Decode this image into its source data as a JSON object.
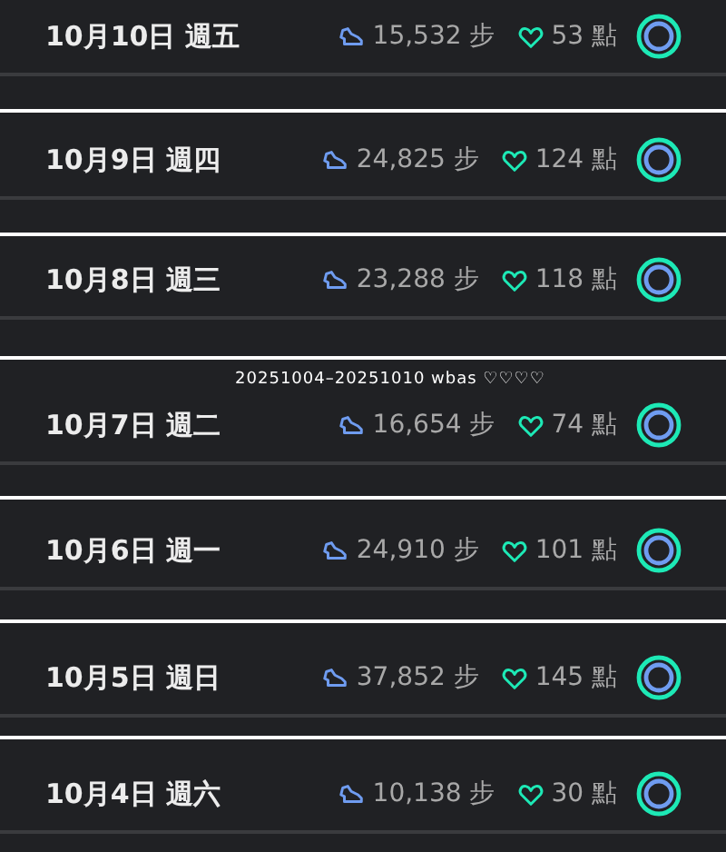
{
  "caption": "20251004–20251010 wbas ♡♡♡♡",
  "days": [
    {
      "date": "10月10日 週五",
      "steps": "15,532 步",
      "points": "53 點"
    },
    {
      "date": "10月9日 週四",
      "steps": "24,825 步",
      "points": "124 點"
    },
    {
      "date": "10月8日 週三",
      "steps": "23,288 步",
      "points": "118 點"
    },
    {
      "date": "10月7日 週二",
      "steps": "16,654 步",
      "points": "74 點"
    },
    {
      "date": "10月6日 週一",
      "steps": "24,910 步",
      "points": "101 點"
    },
    {
      "date": "10月5日 週日",
      "steps": "37,852 步",
      "points": "145 點"
    },
    {
      "date": "10月4日 週六",
      "steps": "10,138 步",
      "points": "30 點"
    }
  ]
}
